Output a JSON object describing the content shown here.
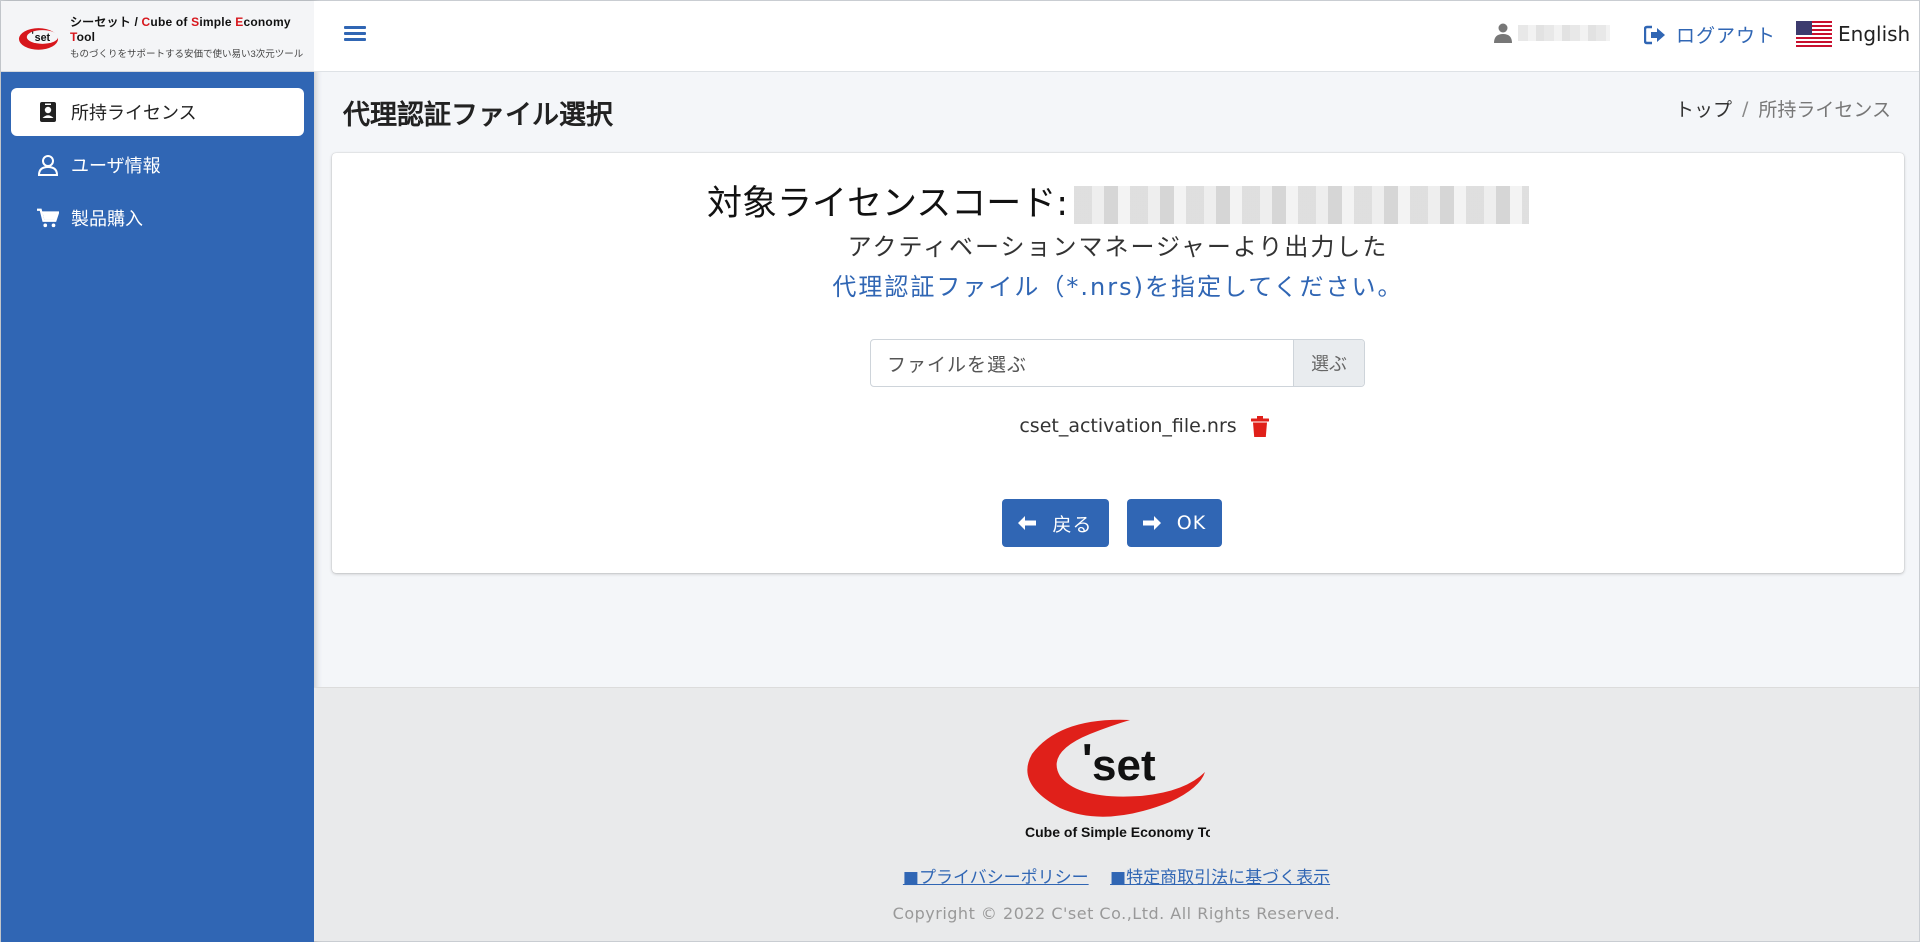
{
  "brand": {
    "title_prefix": "シーセット / ",
    "title_c": "C",
    "title_1": "ube of ",
    "title_s": "S",
    "title_2": "imple ",
    "title_e": "E",
    "title_3": "conomy ",
    "title_t": "T",
    "title_4": "ool",
    "subtitle": "ものづくりをサポートする安価で使い易い3次元ツール",
    "logo_text": "set",
    "accent_color": "#d7161c"
  },
  "sidebar": {
    "bg_color": "#3066b4",
    "items": [
      {
        "label": "所持ライセンス",
        "icon": "id-badge-icon",
        "active": true
      },
      {
        "label": "ユーザ情報",
        "icon": "user-icon",
        "active": false
      },
      {
        "label": "製品購入",
        "icon": "cart-icon",
        "active": false
      }
    ]
  },
  "topbar": {
    "logout_label": "ログアウト",
    "language_label": "English"
  },
  "header": {
    "page_title": "代理認証ファイル選択",
    "breadcrumb": [
      "トップ",
      "所持ライセンス"
    ]
  },
  "card": {
    "license_code_label": "対象ライセンスコード:",
    "instruction_line1": "アクティベーションマネージャーより出力した",
    "instruction_line2": "代理認証ファイル（*.nrs)を指定してください。",
    "file_input_placeholder": "ファイルを選ぶ",
    "browse_label": "選ぶ",
    "selected_file": "cset_activation_file.nrs",
    "back_label": "戻る",
    "ok_label": "OK"
  },
  "footer": {
    "logo_text": "set",
    "logo_caption": "Cube of Simple Economy Tool",
    "privacy_link": "■プライバシーポリシー",
    "commerce_link": "■特定商取引法に基づく表示",
    "copyright": "Copyright © 2022 C'set Co.,Ltd. All Rights Reserved."
  }
}
